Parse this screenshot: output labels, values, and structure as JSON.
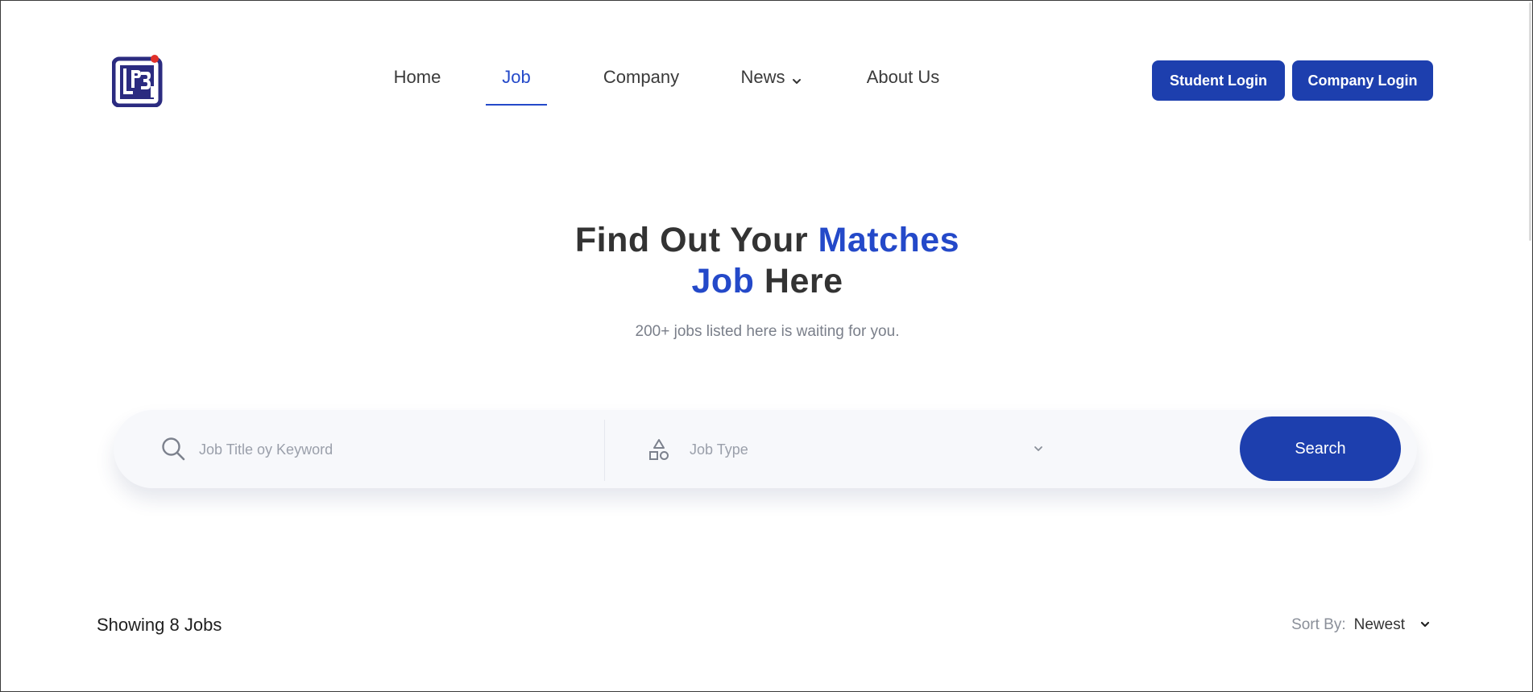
{
  "nav": {
    "items": [
      {
        "label": "Home",
        "active": false
      },
      {
        "label": "Job",
        "active": true
      },
      {
        "label": "Company",
        "active": false
      },
      {
        "label": "News",
        "active": false,
        "dropdown": true
      },
      {
        "label": "About Us",
        "active": false
      }
    ]
  },
  "auth": {
    "student_login": "Student Login",
    "company_login": "Company Login"
  },
  "hero": {
    "title_part1": "Find Out Your ",
    "title_accent1": "Matches",
    "title_accent2": "Job",
    "title_part2": " Here",
    "subtitle": "200+ jobs listed here is waiting for you."
  },
  "search": {
    "keyword_placeholder": "Job Title oy Keyword",
    "job_type_placeholder": "Job Type",
    "button_label": "Search"
  },
  "results": {
    "showing_label": "Showing 8 Jobs",
    "sort_label": "Sort By:",
    "sort_value": "Newest"
  },
  "colors": {
    "accent": "#2449c9",
    "button": "#1d3fae",
    "logo": "#2b2b80",
    "logo_dot": "#e0302a"
  },
  "icons": {
    "logo": "lp3i-logo",
    "keyword": "search-icon",
    "job_type": "shapes-icon",
    "dropdown": "chevron-down-icon"
  }
}
